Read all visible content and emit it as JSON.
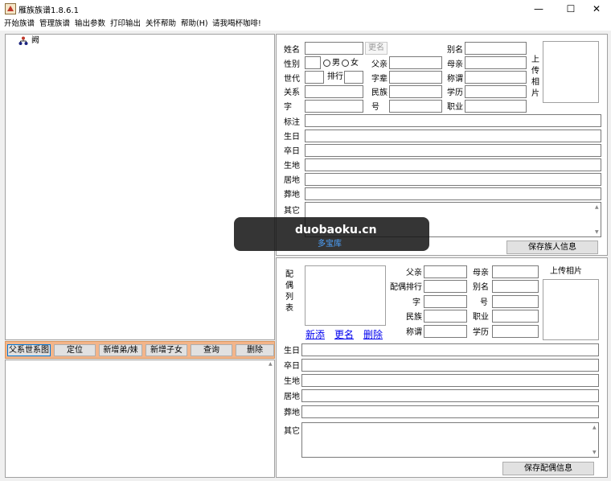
{
  "window": {
    "title": "雁族族谱1.8.6.1",
    "minimize_glyph": "—",
    "maximize_glyph": "☐",
    "close_glyph": "✕"
  },
  "menu": [
    "开始族谱",
    "管理族谱",
    "输出参数",
    "打印输出",
    "关怀帮助",
    "帮助(H)",
    "请我喝杯咖啡!"
  ],
  "tree": {
    "root_label": "阙"
  },
  "toolbar": [
    "父系世系图",
    "定位",
    "新增弟/妹",
    "新增子女",
    "查询",
    "删除"
  ],
  "person": {
    "labels": {
      "name": "姓名",
      "gender": "性别",
      "generation": "世代",
      "relation": "关系",
      "zi": "字",
      "remark": "标注",
      "birth": "生日",
      "death": "卒日",
      "birthplace": "生地",
      "residence": "居地",
      "burial": "葬地",
      "other": "其它",
      "father": "父亲",
      "generation_name": "字辈",
      "ethnicity": "民族",
      "hao": "号",
      "alias": "别名",
      "mother": "母亲",
      "title": "称谓",
      "education": "学历",
      "occupation": "职业",
      "rank": "排行",
      "male": "男",
      "female": "女"
    },
    "rename_button": "更名",
    "upload_photo": [
      "上",
      "传",
      "相",
      "片"
    ],
    "save_button": "保存族人信息"
  },
  "spouse": {
    "list_label": [
      "配",
      "偶",
      "列",
      "表"
    ],
    "links": {
      "add": "新添",
      "rename": "更名",
      "delete": "删除"
    },
    "labels": {
      "father": "父亲",
      "rank": "配偶排行",
      "zi": "字",
      "ethnicity": "民族",
      "title": "称谓",
      "mother": "母亲",
      "alias": "别名",
      "hao": "号",
      "occupation": "职业",
      "education": "学历",
      "birth": "生日",
      "death": "卒日",
      "birthplace": "生地",
      "residence": "居地",
      "burial": "葬地",
      "other": "其它"
    },
    "upload_photo": "上传相片",
    "save_button": "保存配偶信息"
  },
  "watermark": {
    "text": "duobaoku.cn",
    "sub": "多宝库"
  }
}
